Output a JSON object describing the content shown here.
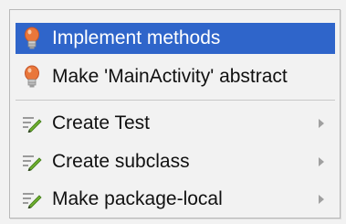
{
  "menu": {
    "items": [
      {
        "label": "Implement methods",
        "icon": "bulb-icon",
        "selected": true,
        "submenu": false
      },
      {
        "label": "Make 'MainActivity' abstract",
        "icon": "bulb-icon",
        "selected": false,
        "submenu": false
      },
      {
        "label": "Create Test",
        "icon": "intention-pencil-icon",
        "selected": false,
        "submenu": true
      },
      {
        "label": "Create subclass",
        "icon": "intention-pencil-icon",
        "selected": false,
        "submenu": true
      },
      {
        "label": "Make package-local",
        "icon": "intention-pencil-icon",
        "selected": false,
        "submenu": true
      }
    ]
  },
  "colors": {
    "selection": "#2f65ca",
    "bulb": "#e9773b",
    "pencil": "#6fae2e"
  }
}
